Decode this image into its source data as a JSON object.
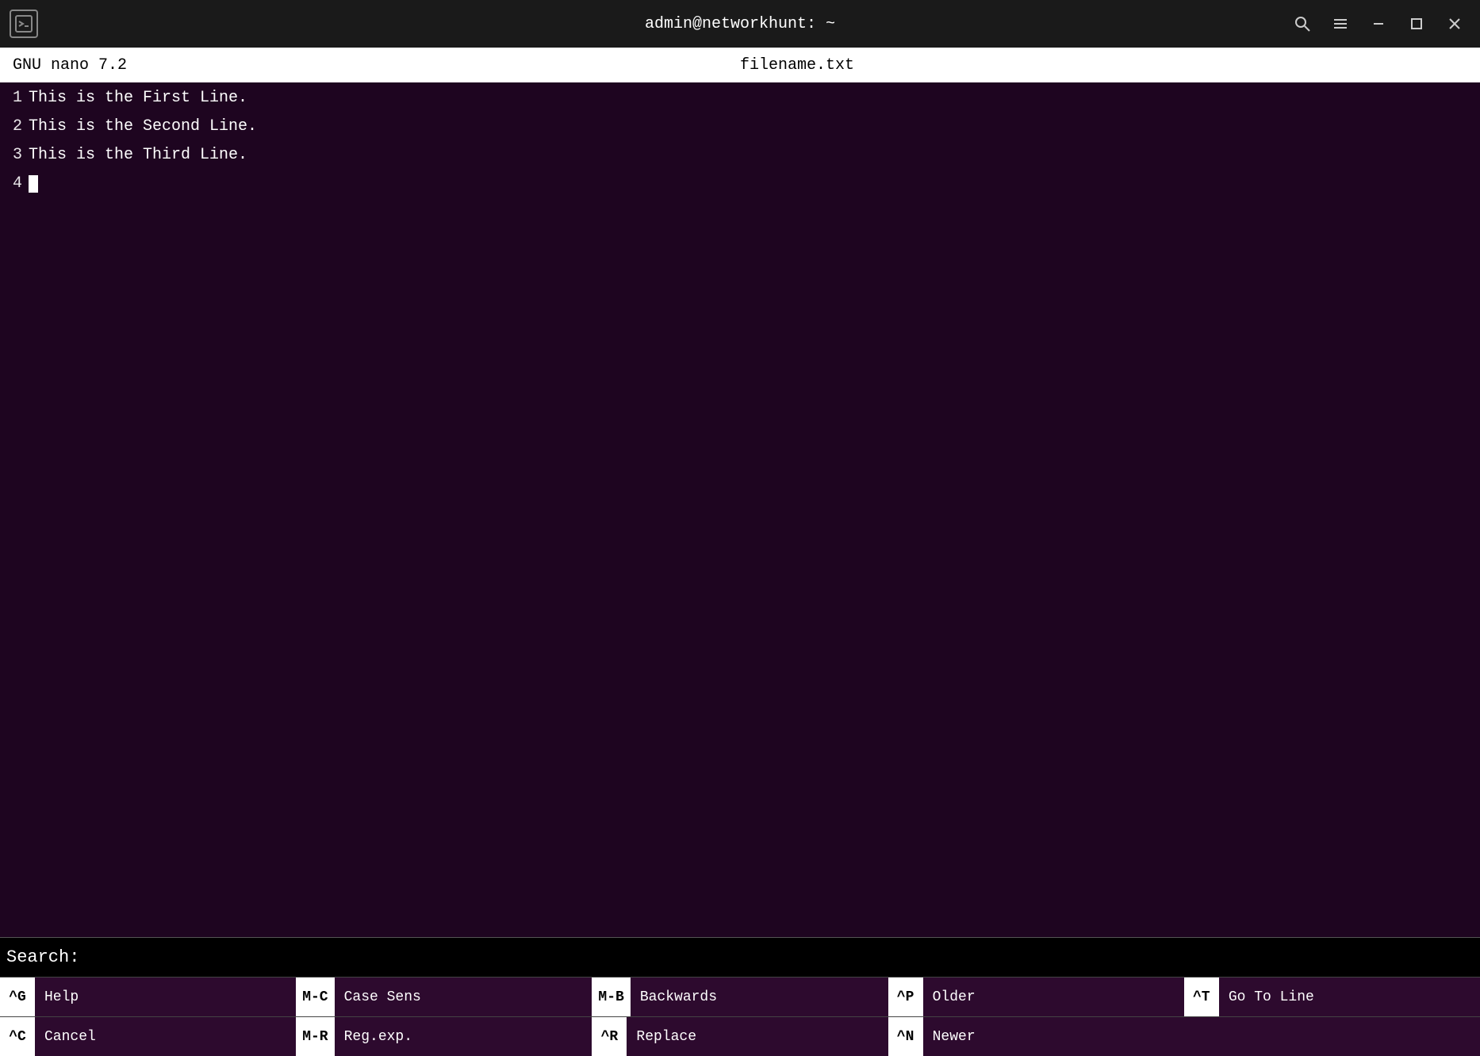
{
  "titlebar": {
    "title": "admin@networkhunt: ~",
    "icon_label": "⊞",
    "search_icon": "🔍",
    "menu_icon": "≡",
    "minimize_icon": "─",
    "maximize_icon": "□",
    "close_icon": "✕"
  },
  "nano_header": {
    "version": "GNU nano 7.2",
    "filename": "filename.txt"
  },
  "editor": {
    "lines": [
      {
        "number": "1",
        "content": "This is the First Line."
      },
      {
        "number": "2",
        "content": "This is the Second Line."
      },
      {
        "number": "3",
        "content": "This is the Third Line."
      },
      {
        "number": "4",
        "content": ""
      }
    ]
  },
  "search_bar": {
    "label": "Search:"
  },
  "shortcuts": {
    "row1": [
      {
        "key": "^G",
        "label": "Help"
      },
      {
        "key": "M-C",
        "label": "Case Sens"
      },
      {
        "key": "M-B",
        "label": "Backwards"
      },
      {
        "key": "^P",
        "label": "Older"
      },
      {
        "key": "^T",
        "label": "Go To Line"
      }
    ],
    "row2": [
      {
        "key": "^C",
        "label": "Cancel"
      },
      {
        "key": "M-R",
        "label": "Reg.exp."
      },
      {
        "key": "^R",
        "label": "Replace"
      },
      {
        "key": "^N",
        "label": "Newer"
      },
      {
        "key": "",
        "label": ""
      }
    ]
  }
}
